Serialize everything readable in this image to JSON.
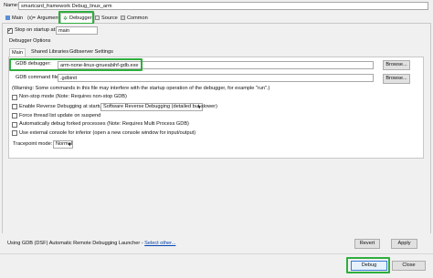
{
  "name_label": "Name:",
  "name_value": "smartcard_framework Debug_linux_arm",
  "tabs": [
    {
      "label": "Main"
    },
    {
      "label": "Arguments"
    },
    {
      "label": "Debugger"
    },
    {
      "label": "Source"
    },
    {
      "label": "Common"
    }
  ],
  "stop_on_startup": {
    "label": "Stop on startup at:",
    "value": "main",
    "checked": true
  },
  "debugger_options_label": "Debugger Options",
  "subtabs": [
    {
      "label": "Main"
    },
    {
      "label": "Shared Libraries"
    },
    {
      "label": "Gdbserver Settings"
    }
  ],
  "gdb_debugger": {
    "label": "GDB debugger:",
    "value": "arm-none-linux-gnueabihf-gdb.exe",
    "browse": "Browse..."
  },
  "gdb_command_file": {
    "label": "GDB command file:",
    "value": ".gdbinit",
    "browse": "Browse..."
  },
  "warning_line1": "(Warning: Some commands in this file may interfere with the startup operation of the debugger, for example \"run\".)",
  "options": {
    "non_stop": "Non-stop mode (Note: Requires non-stop GDB)",
    "reverse": "Enable Reverse Debugging at startup using:",
    "reverse_select": "Software Reverse Debugging (detailed but slower)",
    "force_thread": "Force thread list update on suspend",
    "auto_forked": "Automatically debug forked processes (Note: Requires Multi Process GDB)",
    "external_console": "Use external console for inferior (open a new console window for input/output)"
  },
  "tracepoint": {
    "label": "Tracepoint mode:",
    "value": "Normal"
  },
  "launcher_text": "Using GDB (DSF) Automatic Remote Debugging Launcher - ",
  "launcher_link": "Select other...",
  "revert": "Revert",
  "apply": "Apply",
  "debug": "Debug",
  "close": "Close",
  "colors": {
    "highlight": "#2fae3e",
    "link": "#0645ad"
  }
}
